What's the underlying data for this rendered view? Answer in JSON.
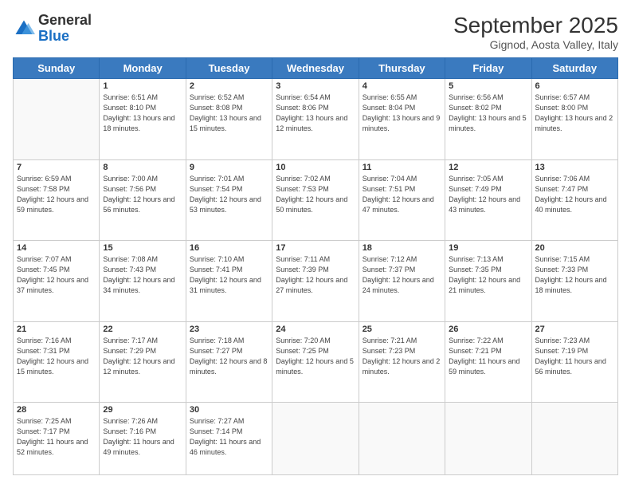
{
  "logo": {
    "general": "General",
    "blue": "Blue"
  },
  "header": {
    "month": "September 2025",
    "location": "Gignod, Aosta Valley, Italy"
  },
  "days_of_week": [
    "Sunday",
    "Monday",
    "Tuesday",
    "Wednesday",
    "Thursday",
    "Friday",
    "Saturday"
  ],
  "weeks": [
    [
      {
        "day": "",
        "sunrise": "",
        "sunset": "",
        "daylight": ""
      },
      {
        "day": "1",
        "sunrise": "Sunrise: 6:51 AM",
        "sunset": "Sunset: 8:10 PM",
        "daylight": "Daylight: 13 hours and 18 minutes."
      },
      {
        "day": "2",
        "sunrise": "Sunrise: 6:52 AM",
        "sunset": "Sunset: 8:08 PM",
        "daylight": "Daylight: 13 hours and 15 minutes."
      },
      {
        "day": "3",
        "sunrise": "Sunrise: 6:54 AM",
        "sunset": "Sunset: 8:06 PM",
        "daylight": "Daylight: 13 hours and 12 minutes."
      },
      {
        "day": "4",
        "sunrise": "Sunrise: 6:55 AM",
        "sunset": "Sunset: 8:04 PM",
        "daylight": "Daylight: 13 hours and 9 minutes."
      },
      {
        "day": "5",
        "sunrise": "Sunrise: 6:56 AM",
        "sunset": "Sunset: 8:02 PM",
        "daylight": "Daylight: 13 hours and 5 minutes."
      },
      {
        "day": "6",
        "sunrise": "Sunrise: 6:57 AM",
        "sunset": "Sunset: 8:00 PM",
        "daylight": "Daylight: 13 hours and 2 minutes."
      }
    ],
    [
      {
        "day": "7",
        "sunrise": "Sunrise: 6:59 AM",
        "sunset": "Sunset: 7:58 PM",
        "daylight": "Daylight: 12 hours and 59 minutes."
      },
      {
        "day": "8",
        "sunrise": "Sunrise: 7:00 AM",
        "sunset": "Sunset: 7:56 PM",
        "daylight": "Daylight: 12 hours and 56 minutes."
      },
      {
        "day": "9",
        "sunrise": "Sunrise: 7:01 AM",
        "sunset": "Sunset: 7:54 PM",
        "daylight": "Daylight: 12 hours and 53 minutes."
      },
      {
        "day": "10",
        "sunrise": "Sunrise: 7:02 AM",
        "sunset": "Sunset: 7:53 PM",
        "daylight": "Daylight: 12 hours and 50 minutes."
      },
      {
        "day": "11",
        "sunrise": "Sunrise: 7:04 AM",
        "sunset": "Sunset: 7:51 PM",
        "daylight": "Daylight: 12 hours and 47 minutes."
      },
      {
        "day": "12",
        "sunrise": "Sunrise: 7:05 AM",
        "sunset": "Sunset: 7:49 PM",
        "daylight": "Daylight: 12 hours and 43 minutes."
      },
      {
        "day": "13",
        "sunrise": "Sunrise: 7:06 AM",
        "sunset": "Sunset: 7:47 PM",
        "daylight": "Daylight: 12 hours and 40 minutes."
      }
    ],
    [
      {
        "day": "14",
        "sunrise": "Sunrise: 7:07 AM",
        "sunset": "Sunset: 7:45 PM",
        "daylight": "Daylight: 12 hours and 37 minutes."
      },
      {
        "day": "15",
        "sunrise": "Sunrise: 7:08 AM",
        "sunset": "Sunset: 7:43 PM",
        "daylight": "Daylight: 12 hours and 34 minutes."
      },
      {
        "day": "16",
        "sunrise": "Sunrise: 7:10 AM",
        "sunset": "Sunset: 7:41 PM",
        "daylight": "Daylight: 12 hours and 31 minutes."
      },
      {
        "day": "17",
        "sunrise": "Sunrise: 7:11 AM",
        "sunset": "Sunset: 7:39 PM",
        "daylight": "Daylight: 12 hours and 27 minutes."
      },
      {
        "day": "18",
        "sunrise": "Sunrise: 7:12 AM",
        "sunset": "Sunset: 7:37 PM",
        "daylight": "Daylight: 12 hours and 24 minutes."
      },
      {
        "day": "19",
        "sunrise": "Sunrise: 7:13 AM",
        "sunset": "Sunset: 7:35 PM",
        "daylight": "Daylight: 12 hours and 21 minutes."
      },
      {
        "day": "20",
        "sunrise": "Sunrise: 7:15 AM",
        "sunset": "Sunset: 7:33 PM",
        "daylight": "Daylight: 12 hours and 18 minutes."
      }
    ],
    [
      {
        "day": "21",
        "sunrise": "Sunrise: 7:16 AM",
        "sunset": "Sunset: 7:31 PM",
        "daylight": "Daylight: 12 hours and 15 minutes."
      },
      {
        "day": "22",
        "sunrise": "Sunrise: 7:17 AM",
        "sunset": "Sunset: 7:29 PM",
        "daylight": "Daylight: 12 hours and 12 minutes."
      },
      {
        "day": "23",
        "sunrise": "Sunrise: 7:18 AM",
        "sunset": "Sunset: 7:27 PM",
        "daylight": "Daylight: 12 hours and 8 minutes."
      },
      {
        "day": "24",
        "sunrise": "Sunrise: 7:20 AM",
        "sunset": "Sunset: 7:25 PM",
        "daylight": "Daylight: 12 hours and 5 minutes."
      },
      {
        "day": "25",
        "sunrise": "Sunrise: 7:21 AM",
        "sunset": "Sunset: 7:23 PM",
        "daylight": "Daylight: 12 hours and 2 minutes."
      },
      {
        "day": "26",
        "sunrise": "Sunrise: 7:22 AM",
        "sunset": "Sunset: 7:21 PM",
        "daylight": "Daylight: 11 hours and 59 minutes."
      },
      {
        "day": "27",
        "sunrise": "Sunrise: 7:23 AM",
        "sunset": "Sunset: 7:19 PM",
        "daylight": "Daylight: 11 hours and 56 minutes."
      }
    ],
    [
      {
        "day": "28",
        "sunrise": "Sunrise: 7:25 AM",
        "sunset": "Sunset: 7:17 PM",
        "daylight": "Daylight: 11 hours and 52 minutes."
      },
      {
        "day": "29",
        "sunrise": "Sunrise: 7:26 AM",
        "sunset": "Sunset: 7:16 PM",
        "daylight": "Daylight: 11 hours and 49 minutes."
      },
      {
        "day": "30",
        "sunrise": "Sunrise: 7:27 AM",
        "sunset": "Sunset: 7:14 PM",
        "daylight": "Daylight: 11 hours and 46 minutes."
      },
      {
        "day": "",
        "sunrise": "",
        "sunset": "",
        "daylight": ""
      },
      {
        "day": "",
        "sunrise": "",
        "sunset": "",
        "daylight": ""
      },
      {
        "day": "",
        "sunrise": "",
        "sunset": "",
        "daylight": ""
      },
      {
        "day": "",
        "sunrise": "",
        "sunset": "",
        "daylight": ""
      }
    ]
  ]
}
